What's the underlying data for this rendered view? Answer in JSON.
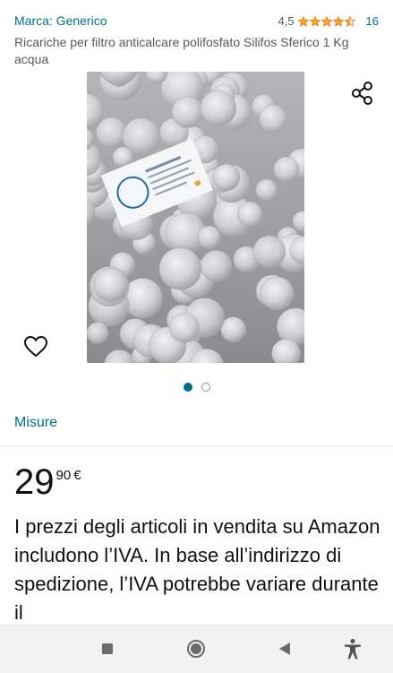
{
  "product": {
    "brand": "Marca: Generico",
    "rating_value": "4,5",
    "rating_stars": 4.5,
    "rating_count": "16",
    "title": "Ricariche per filtro anticalcare polifosfato Silifos Sferico 1 Kg acqua"
  },
  "gallery": {
    "image_count": 2,
    "active_index": 0
  },
  "size_link": "Misure",
  "price": {
    "whole": "29",
    "fraction": "90",
    "symbol": "€"
  },
  "vat_note": "I prezzi degli articoli in vendita su Amazon includono l’IVA. In base all’indirizzo di spedizione, l’IVA potrebbe variare durante il",
  "colors": {
    "link": "#007185",
    "star": "#ffa41c",
    "text": "#0f1111",
    "secondary": "#565959"
  },
  "icons": {
    "share": "share-icon",
    "wishlist": "heart-icon",
    "nav_recents": "square-icon",
    "nav_home": "circle-icon",
    "nav_back": "triangle-back-icon",
    "accessibility": "accessibility-icon"
  }
}
